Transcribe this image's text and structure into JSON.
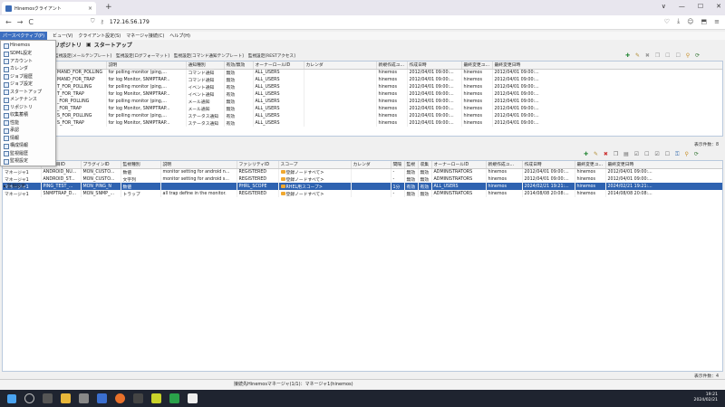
{
  "browser": {
    "tab_title": "Hinemosクライアント",
    "url": "172.16.56.179",
    "back": "←",
    "forward": "→",
    "reload": "C",
    "new_tab": "+",
    "close_tab": "×",
    "window_controls": [
      "∨",
      "—",
      "☐",
      "✕"
    ]
  },
  "menubar": {
    "items": [
      "パースペクティブ(P)",
      "ビュー(V)",
      "クライアント設定(S)",
      "マネージャ接続(C)",
      "ヘルプ(H)"
    ]
  },
  "perspective_label": "リポジトリ",
  "start_label": "スタートアップ",
  "view_tabs": [
    "監視設定[メールテンプレート]",
    "監視設定[ログフォーマット]",
    "監視設定[コマンド通知テンプレート]",
    "監視設定[RESTアクセス]"
  ],
  "dropdown": {
    "items": [
      "Hinemos",
      "SDML設定",
      "アカウント",
      "カレンダ",
      "ジョブ履歴",
      "ジョブ設定",
      "スタートアップ",
      "メンテナンス",
      "リポジトリ",
      "収集蓄積",
      "性能",
      "承認",
      "情報",
      "構成情報",
      "監視履歴",
      "監視設定"
    ],
    "highlighted": "監視設定",
    "monitor_view": "監視設定"
  },
  "upper_table": {
    "headers": [
      "",
      "説明",
      "通知種別",
      "有効/無効",
      "オーナーロールID",
      "カレンダ",
      "新規作成ユ...",
      "作成日時",
      "最終変更ユ...",
      "最終変更日時"
    ],
    "rows": [
      [
        "MAND_FOR_POLLING",
        "for polling monitor (ping,...",
        "コマンド通知",
        "無効",
        "ALL_USERS",
        "",
        "hinemos",
        "2012/04/01 09:00:...",
        "hinemos",
        "2012/04/01 09:00:..."
      ],
      [
        "MAND_FOR_TRAP",
        "for log Monitor, SNMPTRAP...",
        "コマンド通知",
        "無効",
        "ALL_USERS",
        "",
        "hinemos",
        "2012/04/01 09:00:...",
        "hinemos",
        "2012/04/01 09:00:..."
      ],
      [
        "T_FOR_POLLING",
        "for polling monitor (ping,...",
        "イベント通知",
        "有効",
        "ALL_USERS",
        "",
        "hinemos",
        "2012/04/01 09:00:...",
        "hinemos",
        "2012/04/01 09:00:..."
      ],
      [
        "T_FOR_TRAP",
        "for log Monitor, SNMPTRAP...",
        "イベント通知",
        "有効",
        "ALL_USERS",
        "",
        "hinemos",
        "2012/04/01 09:00:...",
        "hinemos",
        "2012/04/01 09:00:..."
      ],
      [
        "_FOR_POLLING",
        "for polling monitor (ping,...",
        "メール通知",
        "無効",
        "ALL_USERS",
        "",
        "hinemos",
        "2012/04/01 09:00:...",
        "hinemos",
        "2012/04/01 09:00:..."
      ],
      [
        "_FOR_TRAP",
        "for log Monitor, SNMPTRAP...",
        "メール通知",
        "無効",
        "ALL_USERS",
        "",
        "hinemos",
        "2012/04/01 09:00:...",
        "hinemos",
        "2012/04/01 09:00:..."
      ],
      [
        "S_FOR_POLLING",
        "for polling monitor (ping,...",
        "ステータス通知",
        "有効",
        "ALL_USERS",
        "",
        "hinemos",
        "2012/04/01 09:00:...",
        "hinemos",
        "2012/04/01 09:00:..."
      ],
      [
        "S_FOR_TRAP",
        "for log Monitor, SNMPTRAP...",
        "ステータス通知",
        "有効",
        "ALL_USERS",
        "",
        "hinemos",
        "2012/04/01 09:00:...",
        "hinemos",
        "2012/04/01 09:00:..."
      ]
    ],
    "count": "表示件数：8"
  },
  "lower_table": {
    "headers": [
      "マネージャ",
      "監視項目ID",
      "プラグインID",
      "監視種別",
      "説明",
      "ファシリティID",
      "スコープ",
      "カレンダ",
      "間隔",
      "監視",
      "収集",
      "オーナーロールID",
      "新規作成ユ...",
      "作成日時",
      "最終変更ユ...",
      "最終変更日時"
    ],
    "rows": [
      [
        "マネージャ1",
        "ANDROID_NU...",
        "MON_CUSTO...",
        "数値",
        "monitor setting for android n...",
        "REGISTERED",
        "登録ノードすべて>",
        "",
        "-",
        "無効",
        "無効",
        "ADMINISTRATORS",
        "hinemos",
        "2012/04/01 09:00:...",
        "hinemos",
        "2012/04/01 09:00:..."
      ],
      [
        "マネージャ1",
        "ANDROID_ST...",
        "MON_CUSTO...",
        "文字列",
        "monitor setting for android s...",
        "REGISTERED",
        "登録ノードすべて>",
        "",
        "-",
        "無効",
        "無効",
        "ADMINISTRATORS",
        "hinemos",
        "2012/04/01 09:00:...",
        "hinemos",
        "2012/04/01 09:00:..."
      ],
      [
        "マネージャ1",
        "PING_TEST_...",
        "MON_PING_N",
        "数値",
        "",
        "PHRL_SCOPE",
        "RHEL用スコープ>",
        "",
        "1分",
        "有効",
        "有効",
        "ALL_USERS",
        "hinemos",
        "2024/02/21 19:21:...",
        "hinemos",
        "2024/02/21 19:21:..."
      ],
      [
        "マネージャ1",
        "SNMPTRAP_D...",
        "MON_SNMP_...",
        "トラップ",
        "all trap define in the monitor.",
        "REGISTERED",
        "登録ノードすべて>",
        "",
        "-",
        "無効",
        "無効",
        "ADMINISTRATORS",
        "hinemos",
        "2014/08/08 20:08:...",
        "hinemos",
        "2014/08/08 20:08:..."
      ]
    ],
    "selected_row": 2,
    "count": "表示件数：4"
  },
  "status": "接続先Hinemosマネージャ(1/1)：マネージャ1(hinemos)",
  "clock": {
    "time": "19:21",
    "date": "2024/02/21"
  },
  "colors": {
    "selection": "#2e62b0",
    "menu_active": "#3d6fc0",
    "highlight_box": "#e02020",
    "taskbar": "#1f2430"
  }
}
